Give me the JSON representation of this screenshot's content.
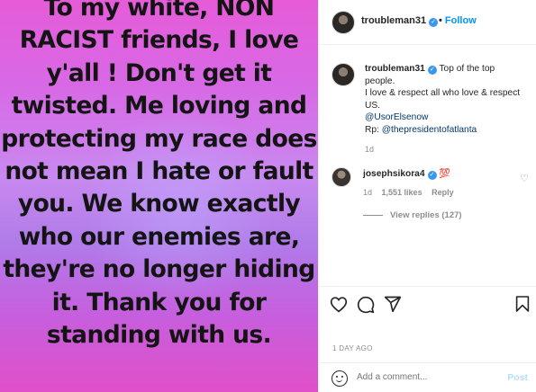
{
  "image": {
    "text": "To my white, NON RACIST friends, I love y'all ! Don't get it twisted. Me loving and protecting my race does not mean I hate or fault you. We know exactly who our enemies are, they're no longer hiding it. Thank you for standing with us."
  },
  "header": {
    "username": "troubleman31",
    "separator": "•",
    "follow_label": "Follow",
    "more_label": "•••"
  },
  "caption": {
    "username": "troubleman31",
    "line1": "Top of the top people.",
    "line2": "I love & respect all who love & respect US.",
    "mention1": "@UsorElsenow",
    "rp_prefix": "Rp: ",
    "mention2": "@thepresidentofatlanta",
    "time": "1d"
  },
  "comment": {
    "username": "josephsikora4",
    "emoji": "💯",
    "time": "1d",
    "likes": "1,551 likes",
    "reply_label": "Reply",
    "view_replies": "View replies (127)"
  },
  "post": {
    "date": "1 DAY AGO"
  },
  "comment_bar": {
    "placeholder": "Add a comment...",
    "post_label": "Post"
  },
  "colors": {
    "accent": "#0095f6",
    "verified": "#3897f0",
    "muted": "#8e8e8e"
  }
}
